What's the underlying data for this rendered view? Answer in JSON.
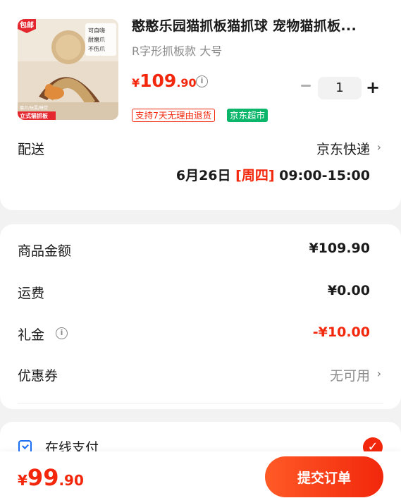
{
  "product": {
    "title": "憨憨乐园猫抓板猫抓球 宠物猫抓板...",
    "spec": "R字形抓板款 大号",
    "price_symbol": "¥",
    "price_int": "109",
    "price_dec": ".90",
    "quantity": "1",
    "tag_return": "支持7天无理由退货",
    "tag_jd": "京东超市",
    "image": {
      "badge": "包邮",
      "features": [
        "可自嗨",
        "耐磨爪",
        "不伤爪"
      ],
      "caption_small": "磨爪/玩耍/睡觉",
      "caption": "立式猫抓板"
    }
  },
  "delivery": {
    "label": "配送",
    "carrier": "京东快递",
    "date": "6月26日",
    "weekday": "[周四]",
    "time": "09:00-15:00"
  },
  "summary": {
    "goods_label": "商品金额",
    "goods_value": "¥109.90",
    "shipping_label": "运费",
    "shipping_value": "¥0.00",
    "gift_label": "礼金",
    "gift_value": "-¥10.00",
    "coupon_label": "优惠券",
    "coupon_value": "无可用"
  },
  "payment": {
    "label": "在线支付"
  },
  "footer": {
    "symbol": "¥",
    "total_int": "99",
    "total_dec": ".90",
    "submit_label": "提交订单"
  },
  "colors": {
    "accent": "#f2270c",
    "jd_green": "#0bb66b",
    "pay_blue": "#1d6ff2"
  }
}
